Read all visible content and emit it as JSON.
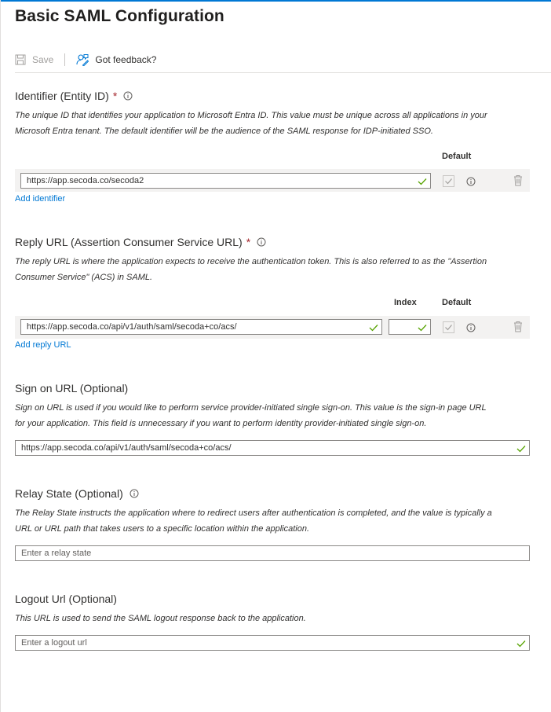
{
  "page": {
    "title": "Basic SAML Configuration"
  },
  "toolbar": {
    "save_label": "Save",
    "feedback_label": "Got feedback?"
  },
  "identifier": {
    "title": "Identifier (Entity ID)",
    "required_mark": "*",
    "description_line1": "The unique ID that identifies your application to Microsoft Entra ID. This value must be unique across all applications in your",
    "description_line2": "Microsoft Entra tenant. The default identifier will be the audience of the SAML response for IDP-initiated SSO.",
    "default_header": "Default",
    "value": "https://app.secoda.co/secoda2",
    "add_link": "Add identifier"
  },
  "reply_url": {
    "title": "Reply URL (Assertion Consumer Service URL)",
    "required_mark": "*",
    "description_line1": "The reply URL is where the application expects to receive the authentication token. This is also referred to as the \"Assertion",
    "description_line2": "Consumer Service\" (ACS) in SAML.",
    "index_header": "Index",
    "default_header": "Default",
    "value": "https://app.secoda.co/api/v1/auth/saml/secoda+co/acs/",
    "index_value": "",
    "add_link": "Add reply URL"
  },
  "sign_on": {
    "title": "Sign on URL (Optional)",
    "description_line1": "Sign on URL is used if you would like to perform service provider-initiated single sign-on. This value is the sign-in page URL",
    "description_line2": "for your application. This field is unnecessary if you want to perform identity provider-initiated single sign-on.",
    "value": "https://app.secoda.co/api/v1/auth/saml/secoda+co/acs/"
  },
  "relay_state": {
    "title": "Relay State (Optional)",
    "description_line1": "The Relay State instructs the application where to redirect users after authentication is completed, and the value is typically a",
    "description_line2": "URL or URL path that takes users to a specific location within the application.",
    "placeholder": "Enter a relay state"
  },
  "logout": {
    "title": "Logout Url (Optional)",
    "description_line1": "This URL is used to send the SAML logout response back to the application.",
    "placeholder": "Enter a logout url"
  },
  "colors": {
    "accent": "#0078d4",
    "valid": "#57a300",
    "required": "#a4262c"
  }
}
